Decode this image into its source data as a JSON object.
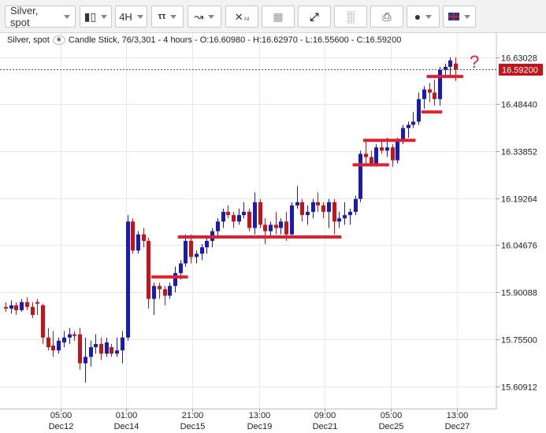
{
  "toolbar": {
    "symbol": "Silver, spot",
    "timeframe": "4H",
    "all_label": "All"
  },
  "info": {
    "symbol": "Silver, spot",
    "description": "Candle Stick, 76/3,301 - 4 hours - O:16.60980 - H:16.62970 - L:16.55600 - C:16.59200"
  },
  "annotation": "?",
  "colors": {
    "up": "#1a1ab4",
    "down": "#c0161b",
    "level_line": "#e0202e",
    "price_tag": "#c0161b"
  },
  "chart_data": {
    "type": "candlestick",
    "current_price": "16.59200",
    "y_ticks": [
      "16.63028",
      "16.48440",
      "16.33852",
      "16.19264",
      "16.04676",
      "15.90088",
      "15.75500",
      "15.60912"
    ],
    "x_ticks": [
      {
        "time": "05:00",
        "date": "Dec12"
      },
      {
        "time": "01:00",
        "date": "Dec14"
      },
      {
        "time": "21:00",
        "date": "Dec15"
      },
      {
        "time": "13:00",
        "date": "Dec19"
      },
      {
        "time": "09:00",
        "date": "Dec21"
      },
      {
        "time": "05:00",
        "date": "Dec25"
      },
      {
        "time": "13:00",
        "date": "Dec27"
      }
    ],
    "ylim": [
      15.58,
      16.66
    ],
    "grid": true,
    "candles": [
      [
        15.855,
        15.87,
        15.84,
        15.85
      ],
      [
        15.85,
        15.875,
        15.835,
        15.86
      ],
      [
        15.86,
        15.87,
        15.83,
        15.845
      ],
      [
        15.845,
        15.88,
        15.84,
        15.87
      ],
      [
        15.87,
        15.885,
        15.845,
        15.855
      ],
      [
        15.855,
        15.87,
        15.82,
        15.83
      ],
      [
        15.87,
        15.88,
        15.83,
        15.865
      ],
      [
        15.86,
        15.865,
        15.74,
        15.76
      ],
      [
        15.76,
        15.79,
        15.72,
        15.73
      ],
      [
        15.735,
        15.78,
        15.7,
        15.72
      ],
      [
        15.72,
        15.76,
        15.71,
        15.75
      ],
      [
        15.745,
        15.78,
        15.73,
        15.76
      ],
      [
        15.76,
        15.79,
        15.74,
        15.77
      ],
      [
        15.77,
        15.78,
        15.75,
        15.765
      ],
      [
        15.77,
        15.79,
        15.66,
        15.68
      ],
      [
        15.68,
        15.76,
        15.62,
        15.7
      ],
      [
        15.7,
        15.75,
        15.67,
        15.73
      ],
      [
        15.73,
        15.77,
        15.71,
        15.74
      ],
      [
        15.74,
        15.76,
        15.69,
        15.71
      ],
      [
        15.71,
        15.76,
        15.7,
        15.745
      ],
      [
        15.73,
        15.74,
        15.7,
        15.71
      ],
      [
        15.71,
        15.76,
        15.7,
        15.72
      ],
      [
        15.72,
        15.78,
        15.68,
        15.76
      ],
      [
        15.76,
        16.14,
        15.75,
        16.12
      ],
      [
        16.12,
        16.13,
        16.02,
        16.03
      ],
      [
        16.03,
        16.09,
        16.02,
        16.08
      ],
      [
        16.08,
        16.1,
        16.04,
        16.06
      ],
      [
        16.06,
        16.07,
        15.85,
        15.88
      ],
      [
        15.88,
        15.93,
        15.83,
        15.92
      ],
      [
        15.92,
        15.93,
        15.88,
        15.91
      ],
      [
        15.91,
        15.92,
        15.86,
        15.89
      ],
      [
        15.89,
        15.93,
        15.88,
        15.92
      ],
      [
        15.92,
        15.98,
        15.9,
        15.96
      ],
      [
        15.96,
        16.0,
        15.94,
        15.99
      ],
      [
        15.99,
        16.08,
        15.98,
        16.06
      ],
      [
        16.06,
        16.08,
        15.99,
        16.01
      ],
      [
        16.01,
        16.03,
        15.99,
        16.02
      ],
      [
        16.02,
        16.05,
        16.0,
        16.04
      ],
      [
        16.04,
        16.07,
        16.02,
        16.06
      ],
      [
        16.06,
        16.1,
        16.04,
        16.09
      ],
      [
        16.09,
        16.13,
        16.07,
        16.12
      ],
      [
        16.12,
        16.16,
        16.1,
        16.15
      ],
      [
        16.15,
        16.17,
        16.13,
        16.14
      ],
      [
        16.14,
        16.15,
        16.1,
        16.12
      ],
      [
        16.12,
        16.16,
        16.11,
        16.14
      ],
      [
        16.14,
        16.18,
        16.13,
        16.15
      ],
      [
        16.15,
        16.16,
        16.09,
        16.1
      ],
      [
        16.1,
        16.21,
        16.08,
        16.18
      ],
      [
        16.18,
        16.19,
        16.1,
        16.11
      ],
      [
        16.11,
        16.13,
        16.05,
        16.09
      ],
      [
        16.09,
        16.12,
        16.07,
        16.11
      ],
      [
        16.11,
        16.15,
        16.08,
        16.1
      ],
      [
        16.1,
        16.13,
        16.08,
        16.12
      ],
      [
        16.12,
        16.15,
        16.06,
        16.08
      ],
      [
        16.08,
        16.18,
        16.07,
        16.17
      ],
      [
        16.17,
        16.23,
        16.16,
        16.18
      ],
      [
        16.18,
        16.19,
        16.12,
        16.14
      ],
      [
        16.14,
        16.17,
        16.11,
        16.15
      ],
      [
        16.15,
        16.19,
        16.13,
        16.18
      ],
      [
        16.18,
        16.21,
        16.15,
        16.17
      ],
      [
        16.17,
        16.18,
        16.13,
        16.15
      ],
      [
        16.15,
        16.19,
        16.1,
        16.18
      ],
      [
        16.18,
        16.19,
        16.08,
        16.12
      ],
      [
        16.12,
        16.15,
        16.1,
        16.13
      ],
      [
        16.13,
        16.18,
        16.11,
        16.14
      ],
      [
        16.14,
        16.16,
        16.11,
        16.15
      ],
      [
        16.15,
        16.2,
        16.14,
        16.19
      ],
      [
        16.19,
        16.34,
        16.18,
        16.33
      ],
      [
        16.33,
        16.37,
        16.3,
        16.32
      ],
      [
        16.32,
        16.34,
        16.29,
        16.3
      ],
      [
        16.3,
        16.36,
        16.29,
        16.35
      ],
      [
        16.35,
        16.37,
        16.33,
        16.34
      ],
      [
        16.34,
        16.38,
        16.32,
        16.35
      ],
      [
        16.35,
        16.36,
        16.29,
        16.31
      ],
      [
        16.31,
        16.38,
        16.3,
        16.37
      ],
      [
        16.37,
        16.42,
        16.36,
        16.41
      ],
      [
        16.41,
        16.43,
        16.38,
        16.42
      ],
      [
        16.42,
        16.46,
        16.41,
        16.43
      ],
      [
        16.43,
        16.52,
        16.42,
        16.5
      ],
      [
        16.5,
        16.54,
        16.47,
        16.53
      ],
      [
        16.53,
        16.55,
        16.49,
        16.52
      ],
      [
        16.52,
        16.56,
        16.48,
        16.5
      ],
      [
        16.5,
        16.6,
        16.48,
        16.59
      ],
      [
        16.59,
        16.61,
        16.57,
        16.6
      ],
      [
        16.6,
        16.63,
        16.57,
        16.62
      ],
      [
        16.61,
        16.63,
        16.556,
        16.592
      ]
    ],
    "levels": [
      {
        "price": 15.948,
        "from": 28,
        "to": 34
      },
      {
        "price": 16.072,
        "from": 33,
        "to": 63
      },
      {
        "price": 16.296,
        "from": 66,
        "to": 72
      },
      {
        "price": 16.372,
        "from": 68,
        "to": 77
      },
      {
        "price": 16.46,
        "from": 79,
        "to": 82
      },
      {
        "price": 16.57,
        "from": 80,
        "to": 86
      }
    ]
  }
}
